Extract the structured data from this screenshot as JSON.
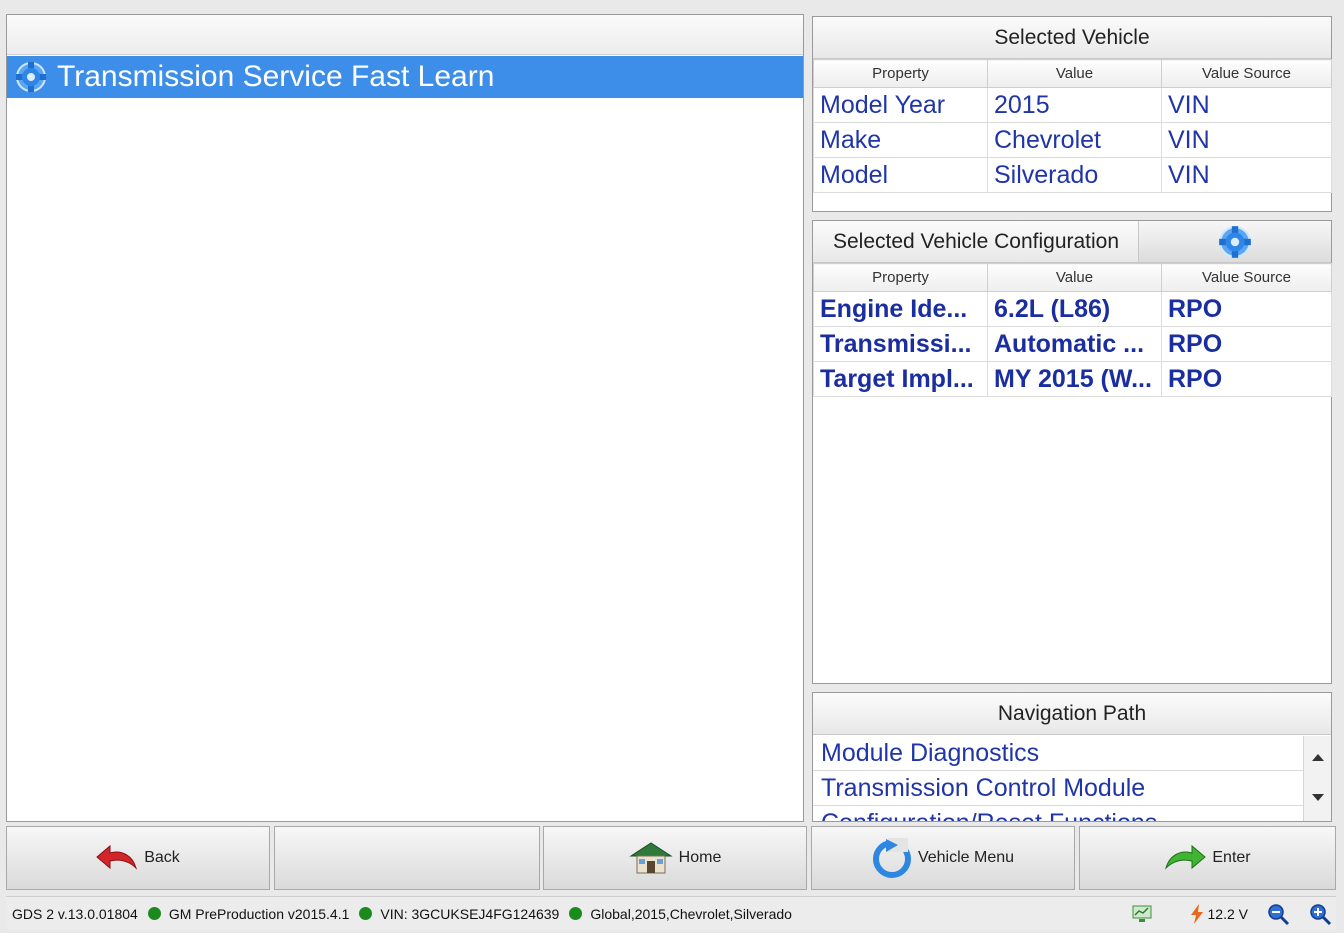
{
  "function_list": {
    "items": [
      {
        "label": "Transmission Service Fast Learn",
        "icon": "gear-icon"
      }
    ]
  },
  "selected_vehicle": {
    "title": "Selected Vehicle",
    "columns": [
      "Property",
      "Value",
      "Value Source"
    ],
    "rows": [
      {
        "property": "Model Year",
        "value": "2015",
        "source": "VIN"
      },
      {
        "property": "Make",
        "value": "Chevrolet",
        "source": "VIN"
      },
      {
        "property": "Model",
        "value": "Silverado",
        "source": "VIN"
      }
    ]
  },
  "vehicle_configuration": {
    "title": "Selected Vehicle Configuration",
    "button_icon": "gear-icon",
    "columns": [
      "Property",
      "Value",
      "Value Source"
    ],
    "rows": [
      {
        "property": "Engine Ide...",
        "value": "6.2L (L86)",
        "source": "RPO"
      },
      {
        "property": "Transmissi...",
        "value": "Automatic ...",
        "source": "RPO"
      },
      {
        "property": "Target Impl...",
        "value": "MY 2015 (W...",
        "source": "RPO"
      }
    ]
  },
  "navigation_path": {
    "title": "Navigation Path",
    "items": [
      "Module Diagnostics",
      "Transmission Control Module",
      "Configuration/Reset Functions"
    ]
  },
  "buttons": {
    "back": "Back",
    "home": "Home",
    "vehicle_menu": "Vehicle Menu",
    "enter": "Enter"
  },
  "status_bar": {
    "version": "GDS 2 v.13.0.01804",
    "environment": "GM PreProduction v2015.4.1",
    "vin": "VIN: 3GCUKSEJ4FG124639",
    "vehicle": "Global,2015,Chevrolet,Silverado",
    "voltage": "12.2 V",
    "indicator_color": "#1d8a1d"
  }
}
